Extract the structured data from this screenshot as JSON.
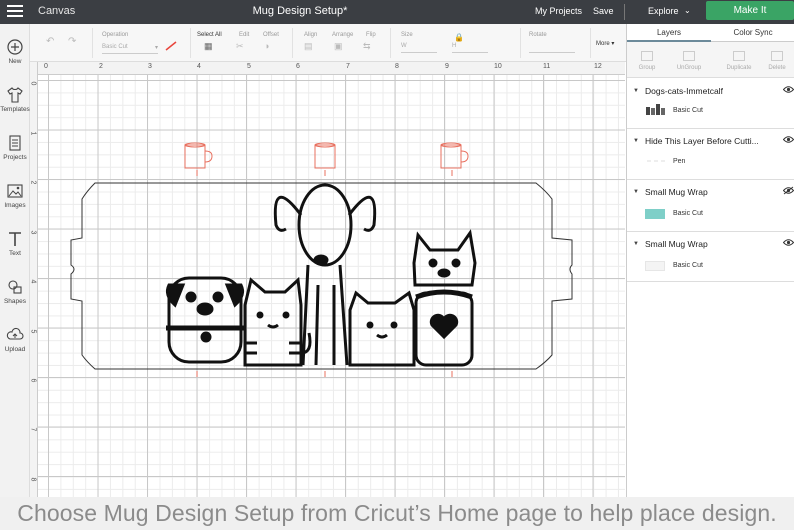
{
  "topbar": {
    "app_label": "Canvas",
    "doc_title": "Mug Design Setup*",
    "my_projects": "My Projects",
    "save": "Save",
    "explore": "Explore",
    "make_it": "Make It",
    "accent_color": "#3aa465"
  },
  "sidebar": {
    "items": [
      {
        "label": "New",
        "icon": "plus-circle-icon"
      },
      {
        "label": "Templates",
        "icon": "tshirt-icon"
      },
      {
        "label": "Projects",
        "icon": "projects-icon"
      },
      {
        "label": "Images",
        "icon": "image-icon"
      },
      {
        "label": "Text",
        "icon": "text-icon"
      },
      {
        "label": "Shapes",
        "icon": "shapes-icon"
      },
      {
        "label": "Upload",
        "icon": "upload-icon"
      }
    ]
  },
  "toolbar": {
    "operation_label": "Operation",
    "operation_value": "Basic Cut",
    "select_all": "Select All",
    "edit": "Edit",
    "offset": "Offset",
    "align": "Align",
    "arrange": "Arrange",
    "flip": "Flip",
    "size": "Size",
    "w": "W",
    "h": "H",
    "rotate": "Rotate",
    "more": "More"
  },
  "rulers": {
    "top": [
      "0",
      "2",
      "3",
      "4",
      "5",
      "6",
      "7",
      "8",
      "9",
      "10",
      "11",
      "12"
    ],
    "left": [
      "0",
      "1",
      "2",
      "3",
      "4",
      "5",
      "6",
      "7",
      "8"
    ]
  },
  "panel": {
    "tab_layers": "Layers",
    "tab_color_sync": "Color Sync",
    "actions": [
      "Group",
      "UnGroup",
      "Duplicate",
      "Delete"
    ],
    "layers": [
      {
        "title": "Dogs-cats-Immetcalf",
        "sub": "Basic Cut",
        "eye": "visible"
      },
      {
        "title": "Hide This Layer Before Cutti...",
        "sub": "Pen",
        "eye": "visible"
      },
      {
        "title": "Small Mug Wrap",
        "sub": "Basic Cut",
        "eye": "hidden",
        "swatch": "#7ecfc8"
      },
      {
        "title": "Small Mug Wrap",
        "sub": "Basic Cut",
        "eye": "visible",
        "swatch": "#f4f4f4"
      }
    ]
  },
  "caption": "Choose Mug Design Setup from Cricut’s Home page to help place design."
}
